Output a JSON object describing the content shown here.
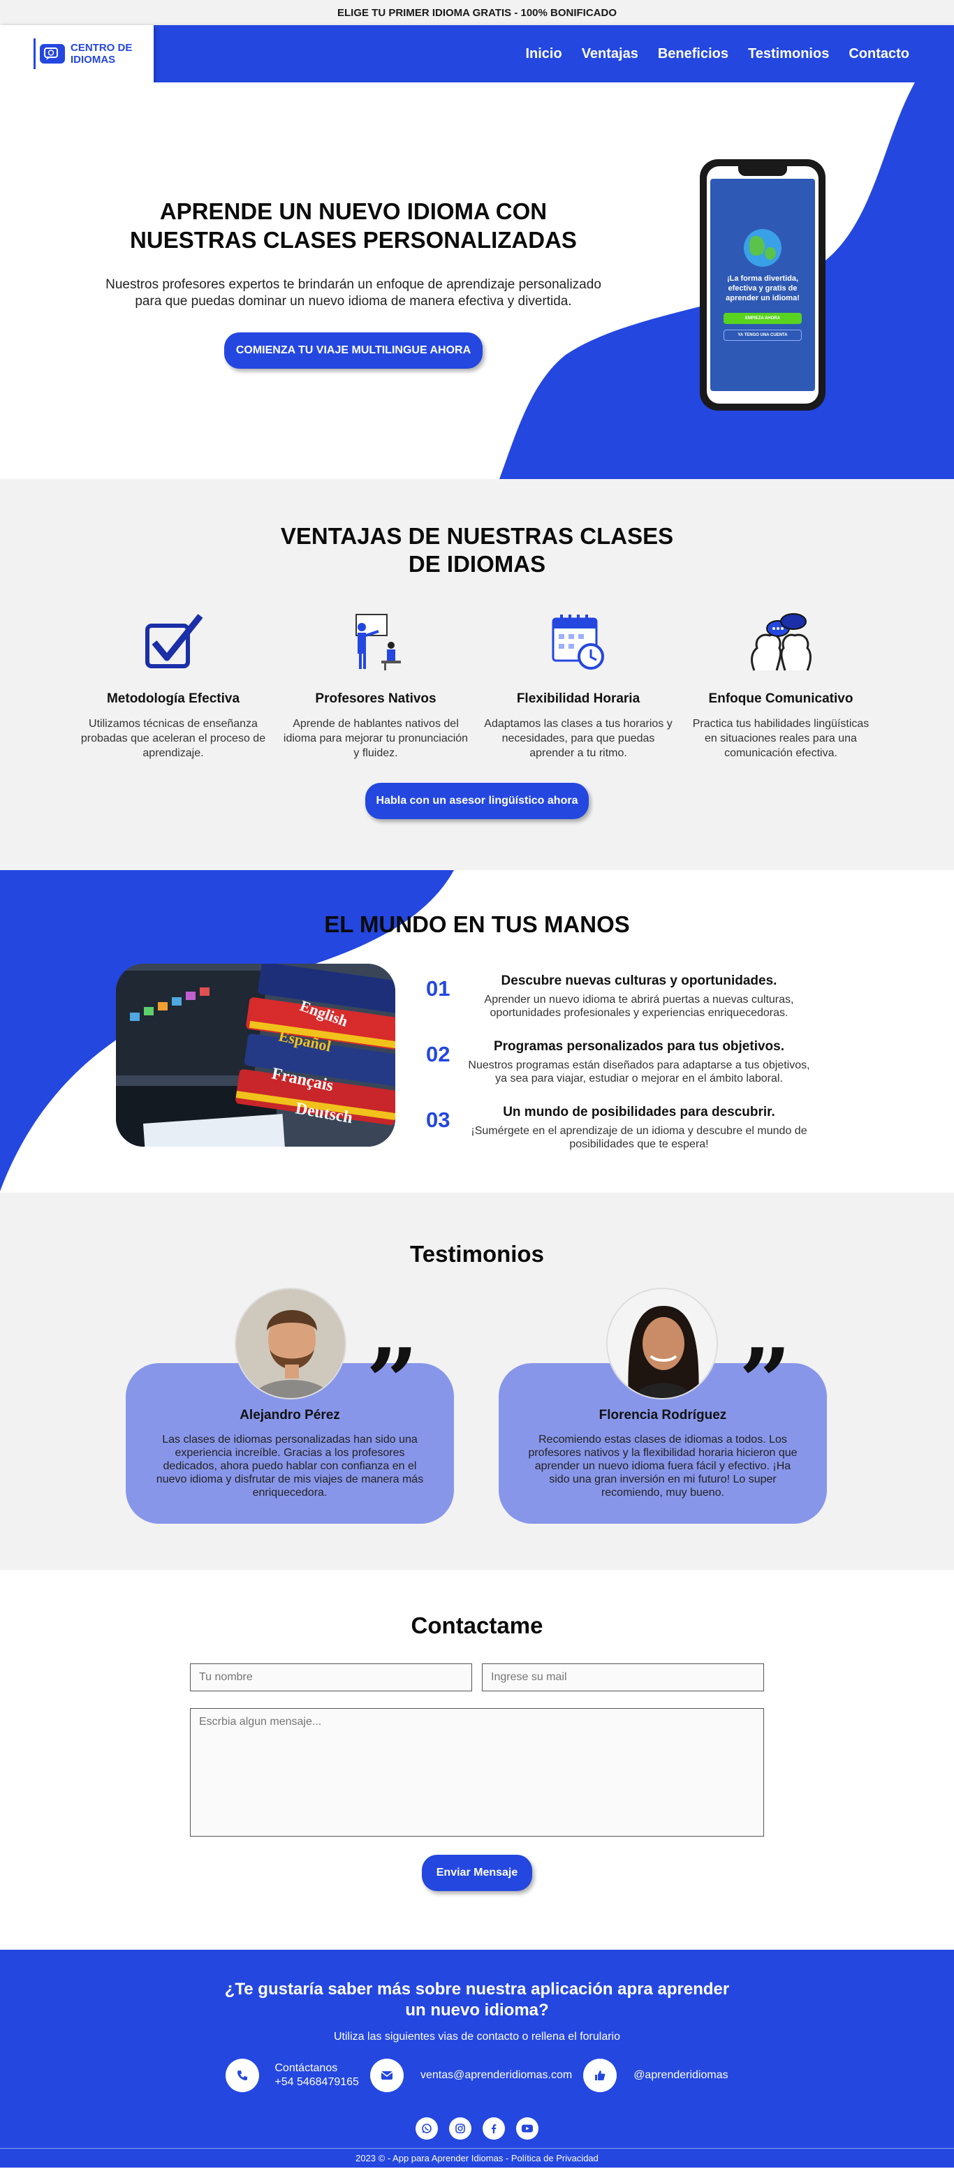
{
  "topbar": {
    "text": "ELIGE TU PRIMER IDIOMA GRATIS - 100% BONIFICADO"
  },
  "nav": {
    "logo_line1": "CENTRO DE",
    "logo_line2": "IDIOMAS",
    "links": [
      "Inicio",
      "Ventajas",
      "Beneficios",
      "Testimonios",
      "Contacto"
    ]
  },
  "hero": {
    "title": "APRENDE UN NUEVO IDIOMA CON NUESTRAS CLASES PERSONALIZADAS",
    "description": "Nuestros profesores expertos te brindarán un enfoque de aprendizaje personalizado para que puedas dominar un nuevo idioma de manera efectiva y divertida.",
    "cta": "COMIENZA TU VIAJE MULTILINGUE AHORA",
    "phone": {
      "message": "¡La forma divertida, efectiva y gratis de aprender un idioma!",
      "btn_primary": "EMPIEZA AHORA",
      "btn_secondary": "YA TENGO UNA CUENTA"
    }
  },
  "ventajas": {
    "title": "VENTAJAS DE NUESTRAS CLASES DE IDIOMAS",
    "items": [
      {
        "title": "Metodología Efectiva",
        "text": "Utilizamos técnicas de enseñanza probadas que aceleran el proceso de aprendizaje.",
        "icon": "checkbox-icon"
      },
      {
        "title": "Profesores Nativos",
        "text": "Aprende de hablantes nativos del idioma para mejorar tu pronunciación y fluidez.",
        "icon": "teacher-icon"
      },
      {
        "title": "Flexibilidad Horaria",
        "text": "Adaptamos las clases a tus horarios y necesidades, para que puedas aprender a tu ritmo.",
        "icon": "calendar-clock-icon"
      },
      {
        "title": "Enfoque Comunicativo",
        "text": "Practica tus habilidades lingüísticas en situaciones reales para una comunicación efectiva.",
        "icon": "conversation-icon"
      }
    ],
    "cta": "Habla con un asesor lingüístico ahora"
  },
  "mundo": {
    "title": "EL MUNDO EN TUS MANOS",
    "books": [
      "English",
      "Español",
      "Français",
      "Deutsch"
    ],
    "points": [
      {
        "num": "01",
        "title": "Descubre nuevas culturas y oportunidades.",
        "text": "Aprender un nuevo idioma te abrirá puertas a nuevas culturas, oportunidades profesionales y experiencias enriquecedoras."
      },
      {
        "num": "02",
        "title": "Programas personalizados para tus objetivos.",
        "text": "Nuestros programas están diseñados para adaptarse a tus objetivos, ya sea para viajar, estudiar o mejorar en el ámbito laboral."
      },
      {
        "num": "03",
        "title": "Un mundo de posibilidades para descubrir.",
        "text": "¡Sumérgete en el aprendizaje de un idioma y descubre el mundo de posibilidades que te espera!"
      }
    ]
  },
  "testimonios": {
    "title": "Testimonios",
    "items": [
      {
        "name": "Alejandro Pérez",
        "text": "Las clases de idiomas personalizadas han sido una experiencia increíble. Gracias a los profesores dedicados, ahora puedo hablar con confianza en el nuevo idioma y disfrutar de mis viajes de manera más enriquecedora."
      },
      {
        "name": "Florencia Rodríguez",
        "text": "Recomiendo estas clases de idiomas a todos. Los profesores nativos y la flexibilidad horaria hicieron que aprender un nuevo idioma fuera fácil y efectivo. ¡Ha sido una gran inversión en mi futuro! Lo super recomiendo, muy bueno."
      }
    ]
  },
  "contact": {
    "title": "Contactame",
    "name_placeholder": "Tu nombre",
    "email_placeholder": "Ingrese su mail",
    "message_placeholder": "Escrbia algun mensaje...",
    "submit": "Enviar Mensaje"
  },
  "footer": {
    "title_line1": "¿Te gustaría saber más sobre nuestra aplicación apra aprender",
    "title_line2": "un nuevo idioma?",
    "subtitle": "Utiliza las siguientes vias de contacto o rellena el forulario",
    "phone_label": "Contáctanos",
    "phone": "+54 5468479165",
    "email": "ventas@aprenderidiomas.com",
    "social_handle": "@aprenderidiomas",
    "copyright": "2023 © - App para Aprender Idiomas - Política de Privacidad"
  },
  "colors": {
    "brand": "#2447e0",
    "card": "#8896ea",
    "section_gray": "#f2f2f2"
  }
}
